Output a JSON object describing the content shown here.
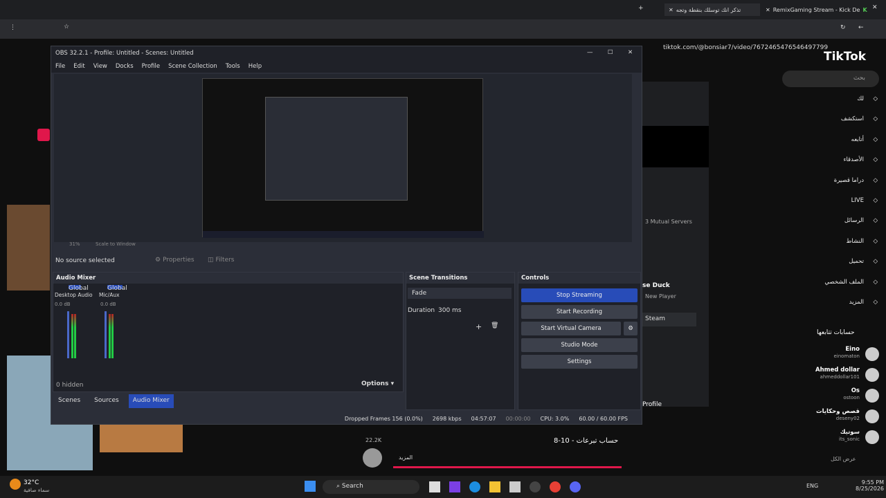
{
  "browser": {
    "tabs": [
      {
        "label": "RemixGaming Stream - Kick De"
      },
      {
        "label": "تذكر انك توسلك بنقطة وتجه"
      }
    ],
    "url": "tiktok.com/@bonsiar7/video/7672465476546497799"
  },
  "tiktok": {
    "logo": "TikTok",
    "search_placeholder": "بحث",
    "nav": [
      "لك",
      "استكشف",
      "أتابعه",
      "الأصدقاء",
      "دراما قصيرة",
      "LIVE",
      "الرسائل",
      "النشاط",
      "تحميل",
      "الملف الشخصي",
      "المزيد"
    ],
    "following_title": "حسابات تتابعها",
    "following": [
      {
        "name": "Eino",
        "handle": "einomaton"
      },
      {
        "name": "Ahmed dollar",
        "handle": "ahmeddollar101"
      },
      {
        "name": "Os",
        "handle": "ostoon"
      },
      {
        "name": "قصص وحكايات",
        "handle": "deseny02"
      },
      {
        "name": "سوتيك",
        "handle": "its_sonic"
      }
    ],
    "show_all": "عرض الكل",
    "likes": "22.2K",
    "video_caption": "حساب تبرعات - 10-8",
    "more": "المزيد"
  },
  "discord": {
    "mutual": "3 Mutual Servers",
    "duck": "se Duck",
    "new_player": "New Player",
    "steam": "Steam",
    "profile": "Profile"
  },
  "obs": {
    "title": "OBS 32.2.1 - Profile: Untitled - Scenes: Untitled",
    "menu": [
      "File",
      "Edit",
      "View",
      "Docks",
      "Profile",
      "Scene Collection",
      "Tools",
      "Help"
    ],
    "no_source": "No source selected",
    "properties": "Properties",
    "filters": "Filters",
    "audio_mixer": {
      "title": "Audio Mixer",
      "channels": [
        {
          "tag": "Global",
          "name": "Desktop Audio",
          "db": "0.0 dB"
        },
        {
          "tag": "Global",
          "name": "Mic/Aux",
          "db": "0.0 dB"
        }
      ],
      "hidden": "0 hidden",
      "options": "Options"
    },
    "scene_transitions": {
      "title": "Scene Transitions",
      "transition": "Fade",
      "duration_label": "Duration",
      "duration": "300 ms"
    },
    "controls": {
      "title": "Controls",
      "buttons": [
        "Stop Streaming",
        "Start Recording",
        "Start Virtual Camera",
        "Studio Mode",
        "Settings"
      ]
    },
    "tabs": [
      "Scenes",
      "Sources",
      "Audio Mixer"
    ],
    "status": {
      "dropped": "Dropped Frames 156 (0.0%)",
      "bitrate": "2698 kbps",
      "stream_time": "04:57:07",
      "rec_time": "00:00:00",
      "cpu": "CPU: 3.0%",
      "fps": "60.00 / 60.00 FPS"
    },
    "preview_zoom": "31%",
    "scale_label": "Scale to Window"
  },
  "taskbar": {
    "weather_temp": "32°C",
    "weather_desc": "سماء صافية",
    "search": "Search",
    "lang": "ENG",
    "time": "9:55 PM",
    "date": "8/25/2026"
  }
}
